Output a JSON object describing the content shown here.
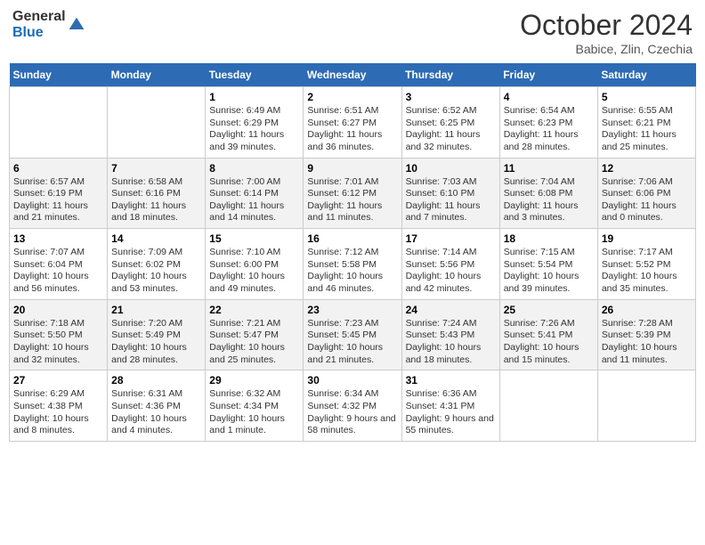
{
  "header": {
    "logo_general": "General",
    "logo_blue": "Blue",
    "month_title": "October 2024",
    "subtitle": "Babice, Zlin, Czechia"
  },
  "days_of_week": [
    "Sunday",
    "Monday",
    "Tuesday",
    "Wednesday",
    "Thursday",
    "Friday",
    "Saturday"
  ],
  "weeks": [
    [
      {
        "day": "",
        "info": ""
      },
      {
        "day": "",
        "info": ""
      },
      {
        "day": "1",
        "info": "Sunrise: 6:49 AM\nSunset: 6:29 PM\nDaylight: 11 hours and 39 minutes."
      },
      {
        "day": "2",
        "info": "Sunrise: 6:51 AM\nSunset: 6:27 PM\nDaylight: 11 hours and 36 minutes."
      },
      {
        "day": "3",
        "info": "Sunrise: 6:52 AM\nSunset: 6:25 PM\nDaylight: 11 hours and 32 minutes."
      },
      {
        "day": "4",
        "info": "Sunrise: 6:54 AM\nSunset: 6:23 PM\nDaylight: 11 hours and 28 minutes."
      },
      {
        "day": "5",
        "info": "Sunrise: 6:55 AM\nSunset: 6:21 PM\nDaylight: 11 hours and 25 minutes."
      }
    ],
    [
      {
        "day": "6",
        "info": "Sunrise: 6:57 AM\nSunset: 6:19 PM\nDaylight: 11 hours and 21 minutes."
      },
      {
        "day": "7",
        "info": "Sunrise: 6:58 AM\nSunset: 6:16 PM\nDaylight: 11 hours and 18 minutes."
      },
      {
        "day": "8",
        "info": "Sunrise: 7:00 AM\nSunset: 6:14 PM\nDaylight: 11 hours and 14 minutes."
      },
      {
        "day": "9",
        "info": "Sunrise: 7:01 AM\nSunset: 6:12 PM\nDaylight: 11 hours and 11 minutes."
      },
      {
        "day": "10",
        "info": "Sunrise: 7:03 AM\nSunset: 6:10 PM\nDaylight: 11 hours and 7 minutes."
      },
      {
        "day": "11",
        "info": "Sunrise: 7:04 AM\nSunset: 6:08 PM\nDaylight: 11 hours and 3 minutes."
      },
      {
        "day": "12",
        "info": "Sunrise: 7:06 AM\nSunset: 6:06 PM\nDaylight: 11 hours and 0 minutes."
      }
    ],
    [
      {
        "day": "13",
        "info": "Sunrise: 7:07 AM\nSunset: 6:04 PM\nDaylight: 10 hours and 56 minutes."
      },
      {
        "day": "14",
        "info": "Sunrise: 7:09 AM\nSunset: 6:02 PM\nDaylight: 10 hours and 53 minutes."
      },
      {
        "day": "15",
        "info": "Sunrise: 7:10 AM\nSunset: 6:00 PM\nDaylight: 10 hours and 49 minutes."
      },
      {
        "day": "16",
        "info": "Sunrise: 7:12 AM\nSunset: 5:58 PM\nDaylight: 10 hours and 46 minutes."
      },
      {
        "day": "17",
        "info": "Sunrise: 7:14 AM\nSunset: 5:56 PM\nDaylight: 10 hours and 42 minutes."
      },
      {
        "day": "18",
        "info": "Sunrise: 7:15 AM\nSunset: 5:54 PM\nDaylight: 10 hours and 39 minutes."
      },
      {
        "day": "19",
        "info": "Sunrise: 7:17 AM\nSunset: 5:52 PM\nDaylight: 10 hours and 35 minutes."
      }
    ],
    [
      {
        "day": "20",
        "info": "Sunrise: 7:18 AM\nSunset: 5:50 PM\nDaylight: 10 hours and 32 minutes."
      },
      {
        "day": "21",
        "info": "Sunrise: 7:20 AM\nSunset: 5:49 PM\nDaylight: 10 hours and 28 minutes."
      },
      {
        "day": "22",
        "info": "Sunrise: 7:21 AM\nSunset: 5:47 PM\nDaylight: 10 hours and 25 minutes."
      },
      {
        "day": "23",
        "info": "Sunrise: 7:23 AM\nSunset: 5:45 PM\nDaylight: 10 hours and 21 minutes."
      },
      {
        "day": "24",
        "info": "Sunrise: 7:24 AM\nSunset: 5:43 PM\nDaylight: 10 hours and 18 minutes."
      },
      {
        "day": "25",
        "info": "Sunrise: 7:26 AM\nSunset: 5:41 PM\nDaylight: 10 hours and 15 minutes."
      },
      {
        "day": "26",
        "info": "Sunrise: 7:28 AM\nSunset: 5:39 PM\nDaylight: 10 hours and 11 minutes."
      }
    ],
    [
      {
        "day": "27",
        "info": "Sunrise: 6:29 AM\nSunset: 4:38 PM\nDaylight: 10 hours and 8 minutes."
      },
      {
        "day": "28",
        "info": "Sunrise: 6:31 AM\nSunset: 4:36 PM\nDaylight: 10 hours and 4 minutes."
      },
      {
        "day": "29",
        "info": "Sunrise: 6:32 AM\nSunset: 4:34 PM\nDaylight: 10 hours and 1 minute."
      },
      {
        "day": "30",
        "info": "Sunrise: 6:34 AM\nSunset: 4:32 PM\nDaylight: 9 hours and 58 minutes."
      },
      {
        "day": "31",
        "info": "Sunrise: 6:36 AM\nSunset: 4:31 PM\nDaylight: 9 hours and 55 minutes."
      },
      {
        "day": "",
        "info": ""
      },
      {
        "day": "",
        "info": ""
      }
    ]
  ]
}
